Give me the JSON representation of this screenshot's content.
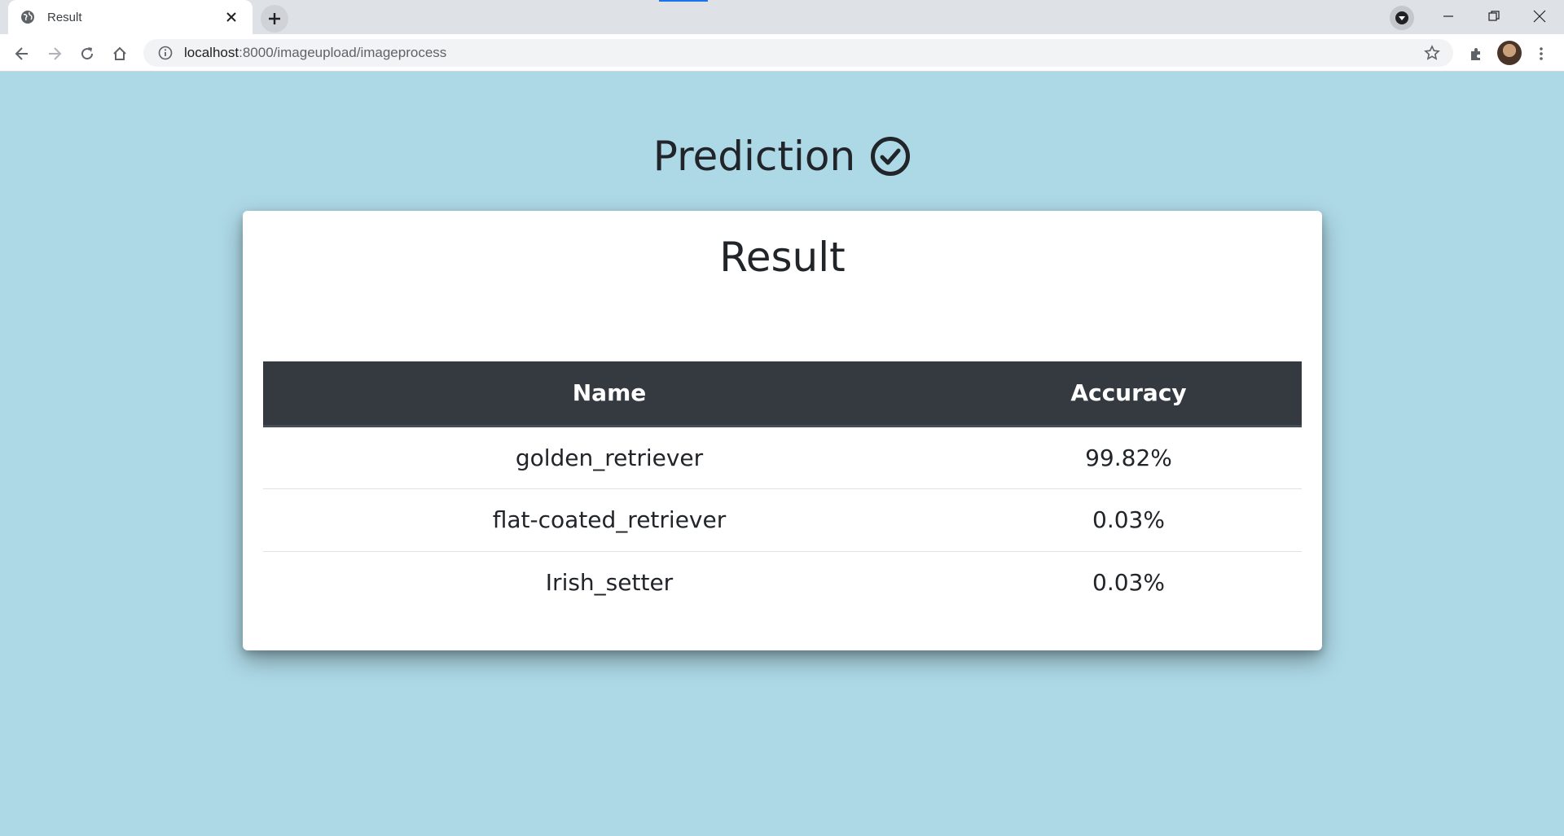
{
  "browser": {
    "tab_title": "Result",
    "url_host": "localhost",
    "url_path": ":8000/imageupload/imageprocess"
  },
  "page": {
    "heading": "Prediction"
  },
  "card": {
    "title": "Result",
    "table": {
      "headers": [
        "Name",
        "Accuracy"
      ],
      "rows": [
        [
          "golden_retriever",
          "99.82%"
        ],
        [
          "flat-coated_retriever",
          "0.03%"
        ],
        [
          "Irish_setter",
          "0.03%"
        ]
      ]
    }
  },
  "colors": {
    "page_background": "#add8e6",
    "table_header": "#343a40"
  }
}
